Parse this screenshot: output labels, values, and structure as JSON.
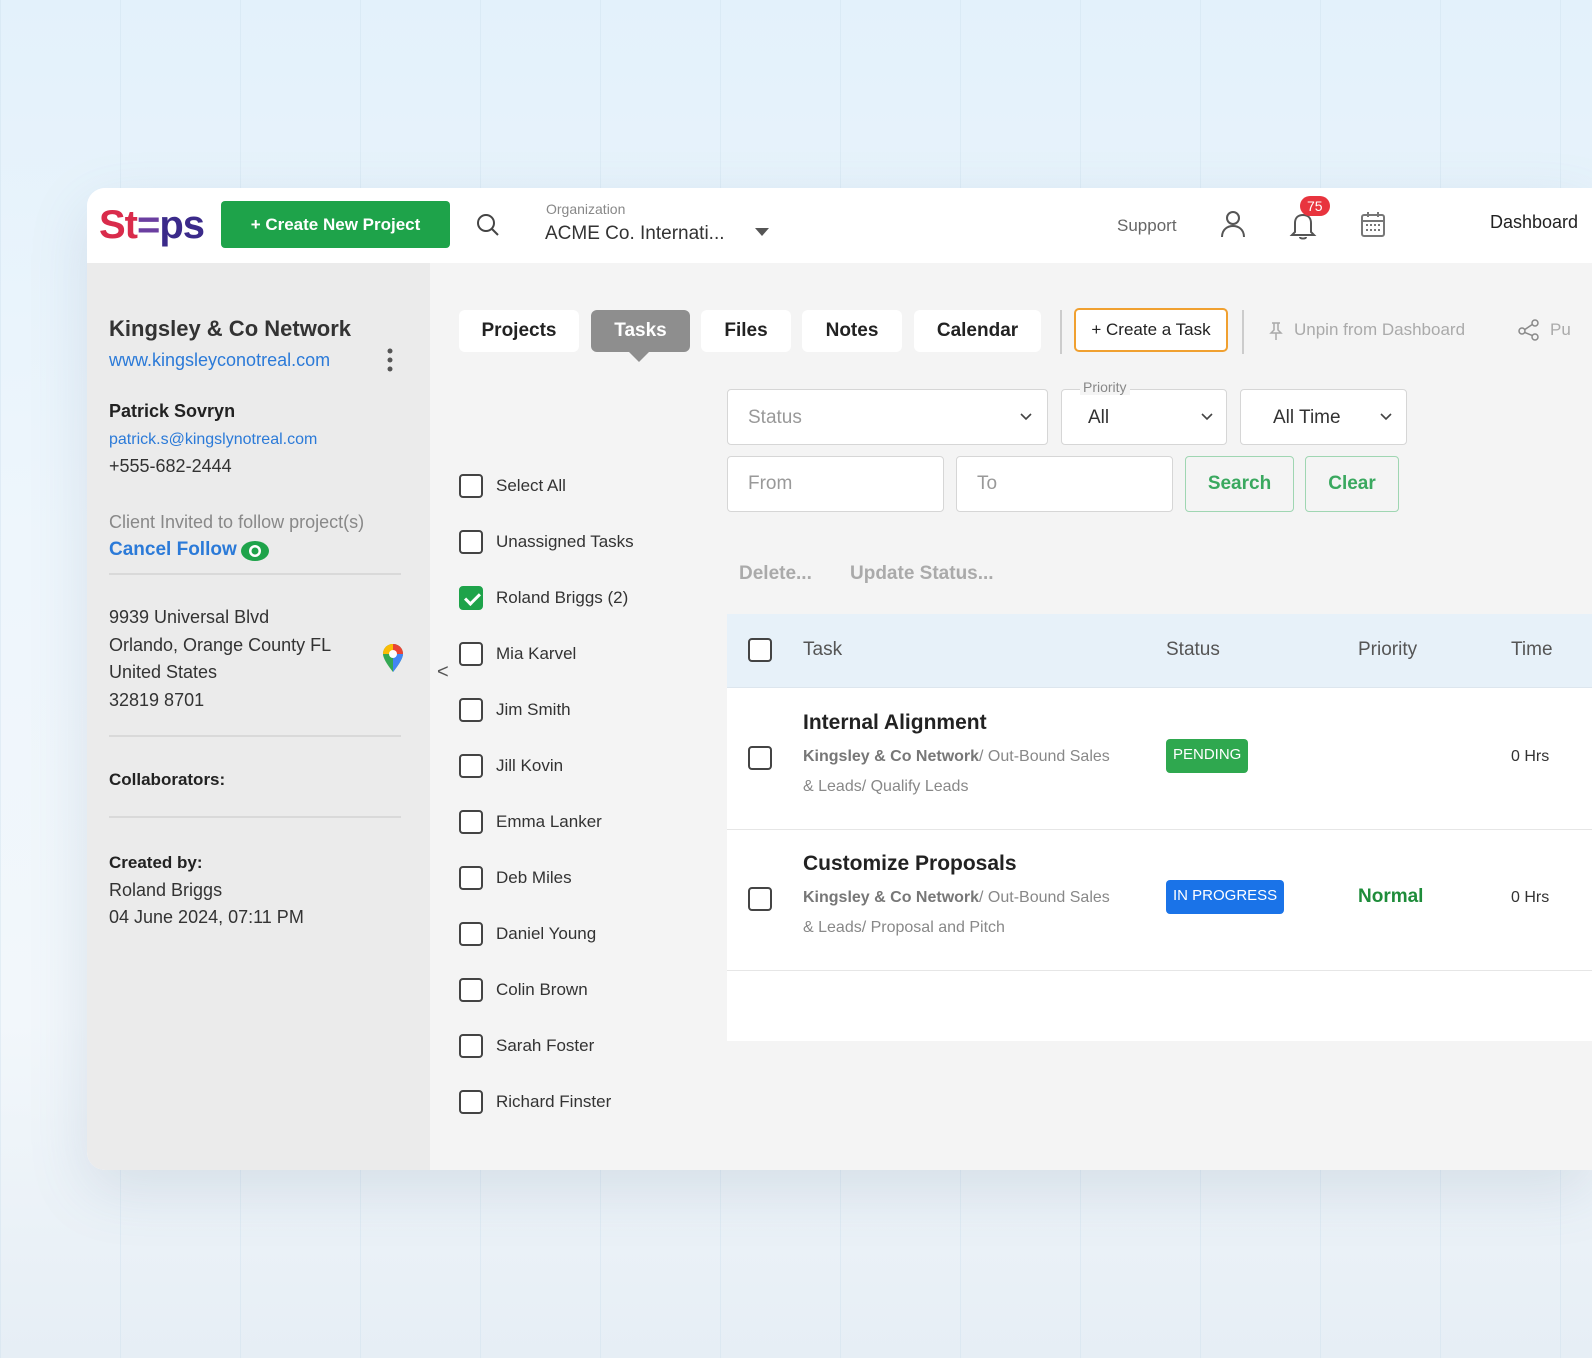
{
  "header": {
    "logo": {
      "st": "St",
      "e": "=",
      "ps": "ps"
    },
    "create_project_label": "+ Create New Project",
    "org_label": "Organization",
    "org_value": "ACME Co. Internati...",
    "support_label": "Support",
    "notifications_count": "75",
    "dashboard_label": "Dashboard"
  },
  "client": {
    "name": "Kingsley & Co Network",
    "url": "www.kingsleyconotreal.com",
    "contact_name": "Patrick Sovryn",
    "contact_email": "patrick.s@kingslynotreal.com",
    "contact_phone": "+555-682-2444",
    "invited_text": "Client Invited to follow project(s)",
    "cancel_follow_label": "Cancel Follow",
    "address": [
      "9939 Universal Blvd",
      "Orlando, Orange County FL",
      "United States",
      "32819 8701"
    ],
    "collaborators_label": "Collaborators:",
    "created_by_label": "Created by:",
    "created_by": "Roland Briggs",
    "created_at": "04 June 2024, 07:11 PM"
  },
  "tabs": [
    {
      "label": "Projects",
      "active": false
    },
    {
      "label": "Tasks",
      "active": true
    },
    {
      "label": "Files",
      "active": false
    },
    {
      "label": "Notes",
      "active": false
    },
    {
      "label": "Calendar",
      "active": false
    }
  ],
  "toolbar": {
    "create_task_label": "+ Create a Task",
    "unpin_label": "Unpin from Dashboard",
    "share_label": "Pu"
  },
  "filters": {
    "status_placeholder": "Status",
    "priority_label": "Priority",
    "priority_value": "All",
    "time_value": "All Time",
    "from_placeholder": "From",
    "to_placeholder": "To",
    "search_label": "Search",
    "clear_label": "Clear"
  },
  "assignees": [
    {
      "label": "Select All",
      "checked": false
    },
    {
      "label": "Unassigned Tasks",
      "checked": false
    },
    {
      "label": "Roland Briggs (2)",
      "checked": true
    },
    {
      "label": "Mia Karvel",
      "checked": false
    },
    {
      "label": "Jim Smith",
      "checked": false
    },
    {
      "label": "Jill Kovin",
      "checked": false
    },
    {
      "label": "Emma Lanker",
      "checked": false
    },
    {
      "label": "Deb Miles",
      "checked": false
    },
    {
      "label": "Daniel Young",
      "checked": false
    },
    {
      "label": "Colin Brown",
      "checked": false
    },
    {
      "label": "Sarah Foster",
      "checked": false
    },
    {
      "label": "Richard Finster",
      "checked": false
    }
  ],
  "collapse_label": "<",
  "bulk_actions": {
    "delete_label": "Delete...",
    "update_status_label": "Update Status..."
  },
  "table": {
    "columns": {
      "task": "Task",
      "status": "Status",
      "priority": "Priority",
      "time": "Time"
    },
    "rows": [
      {
        "title": "Internal Alignment",
        "project": "Kingsley & Co Network",
        "path_line1": "/ Out-Bound Sales",
        "path_line2": "& Leads/ Qualify Leads",
        "status": "PENDING",
        "status_color": "#2fa84f",
        "priority": "",
        "time": "0 Hrs"
      },
      {
        "title": "Customize Proposals",
        "project": "Kingsley & Co Network",
        "path_line1": "/ Out-Bound Sales",
        "path_line2": "& Leads/ Proposal and Pitch",
        "status": "IN PROGRESS",
        "status_color": "#1a73e8",
        "priority": "Normal",
        "time": "0 Hrs"
      }
    ]
  },
  "colors": {
    "brand_green": "#1ea34a",
    "link_blue": "#2b7ad8",
    "accent_orange": "#f0a030"
  }
}
